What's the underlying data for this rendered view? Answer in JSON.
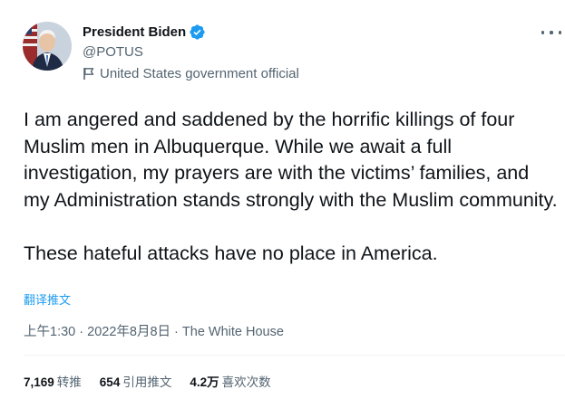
{
  "author": {
    "name": "President Biden",
    "handle": "@POTUS",
    "label": "United States government official"
  },
  "tweet": {
    "text": "I am angered and saddened by the horrific killings of four Muslim men in Albuquerque. While we await a full investigation, my prayers are with the victims’ families, and my Administration stands strongly with the Muslim community.\n\nThese hateful attacks have no place in America.",
    "translate_label": "翻译推文"
  },
  "meta": {
    "time": "上午1:30",
    "separator": " · ",
    "date": "2022年8月8日",
    "source": "The White House"
  },
  "stats": [
    {
      "count": "7,169",
      "label": "转推"
    },
    {
      "count": "654",
      "label": "引用推文"
    },
    {
      "count": "4.2万",
      "label": "喜欢次数"
    }
  ],
  "icons": {
    "verified": "verified-badge-icon",
    "government": "government-flag-icon",
    "more": "more-options-icon"
  },
  "colors": {
    "accent": "#1d9bf0",
    "secondary_text": "#536471",
    "primary_text": "#0f1419"
  }
}
